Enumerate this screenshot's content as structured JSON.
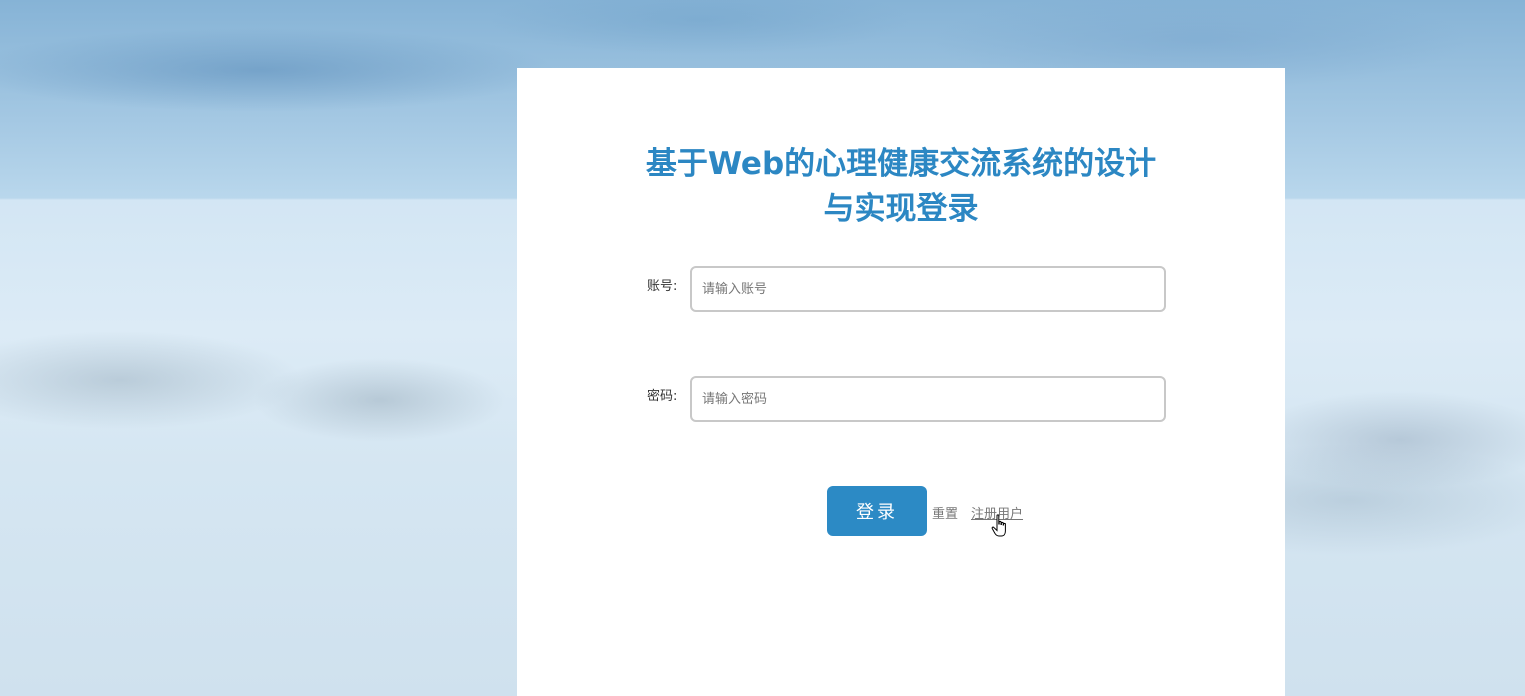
{
  "page": {
    "title_line1": "基于Web的心理健康交流系统的设计",
    "title_line2": "与实现登录"
  },
  "form": {
    "account_label": "账号:",
    "account_placeholder": "请输入账号",
    "account_value": "",
    "password_label": "密码:",
    "password_placeholder": "请输入密码",
    "password_value": "",
    "login_button": "登录",
    "reset_link": "重置",
    "register_link": "注册用户"
  },
  "colors": {
    "accent": "#2c87c3",
    "button": "#2c8ac5",
    "link": "#777777"
  },
  "icons": {
    "cursor": "hand-pointer-icon"
  }
}
